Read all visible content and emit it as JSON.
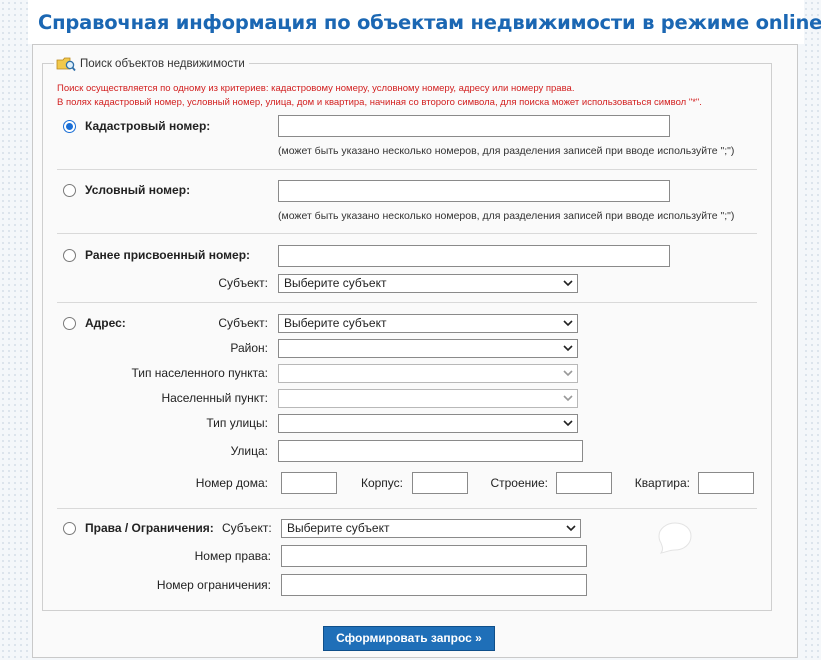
{
  "page_title": "Справочная информация по объектам недвижимости в режиме online",
  "fieldset_legend": "Поиск объектов недвижимости",
  "notice": {
    "line1": "Поиск осуществляется по одному из критериев: кадастровому номеру, условному номеру, адресу или номеру права.",
    "line2": "В полях кадастровый номер, условный номер, улица, дом и квартира, начиная со второго символа, для поиска может использоваться символ \"*\"."
  },
  "hint_multi": "(может быть указано несколько номеров, для разделения записей при вводе используйте \";\")",
  "cadastral": {
    "label": "Кадастровый номер:",
    "checked": true,
    "value": ""
  },
  "conditional": {
    "label": "Условный номер:",
    "checked": false,
    "value": ""
  },
  "previous": {
    "label": "Ранее присвоенный номер:",
    "checked": false,
    "value": "",
    "subject_label": "Субъект:",
    "subject_value": "Выберите субъект"
  },
  "address": {
    "label": "Адрес:",
    "checked": false,
    "subject_label": "Субъект:",
    "subject_value": "Выберите субъект",
    "district_label": "Район:",
    "district_value": "",
    "settlement_type_label": "Тип населенного пункта:",
    "settlement_type_value": "",
    "settlement_label": "Населенный пункт:",
    "settlement_value": "",
    "street_type_label": "Тип улицы:",
    "street_type_value": "",
    "street_label": "Улица:",
    "house_label": "Номер дома:",
    "building_label": "Корпус:",
    "structure_label": "Строение:",
    "apartment_label": "Квартира:"
  },
  "rights": {
    "label": "Права / Ограничения:",
    "checked": false,
    "subject_label": "Субъект:",
    "subject_value": "Выберите субъект",
    "right_number_label": "Номер права:",
    "restriction_number_label": "Номер ограничения:"
  },
  "submit_button": "Сформировать запрос »",
  "colors": {
    "title": "#1b67b3",
    "notice": "#d21f1f",
    "button": "#1f6fb8",
    "radio_checked": "#1a6fd6"
  }
}
